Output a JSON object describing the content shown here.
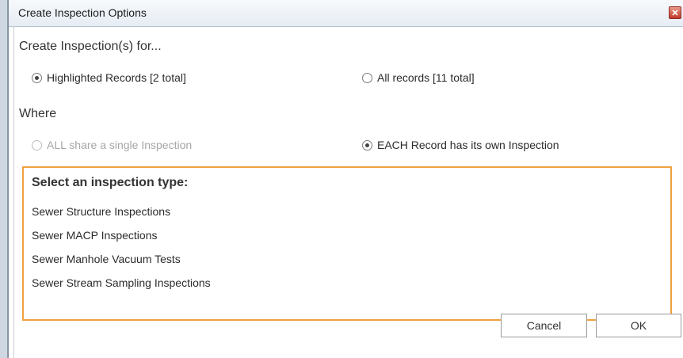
{
  "window": {
    "title": "Create Inspection Options"
  },
  "create_for": {
    "heading": "Create Inspection(s) for...",
    "options": [
      {
        "label": "Highlighted Records [2 total]",
        "checked": true,
        "disabled": false
      },
      {
        "label": "All records [11 total]",
        "checked": false,
        "disabled": false
      }
    ]
  },
  "where": {
    "heading": "Where",
    "options": [
      {
        "label": "ALL share a single Inspection",
        "checked": false,
        "disabled": true
      },
      {
        "label": "EACH Record has its own Inspection",
        "checked": true,
        "disabled": false
      }
    ]
  },
  "inspection_type": {
    "heading": "Select an inspection type:",
    "items": [
      "Sewer Structure Inspections",
      "Sewer MACP Inspections",
      "Sewer Manhole Vacuum Tests",
      "Sewer Stream Sampling Inspections"
    ],
    "highlight_color": "#f0a040"
  },
  "buttons": {
    "cancel": "Cancel",
    "ok": "OK"
  }
}
